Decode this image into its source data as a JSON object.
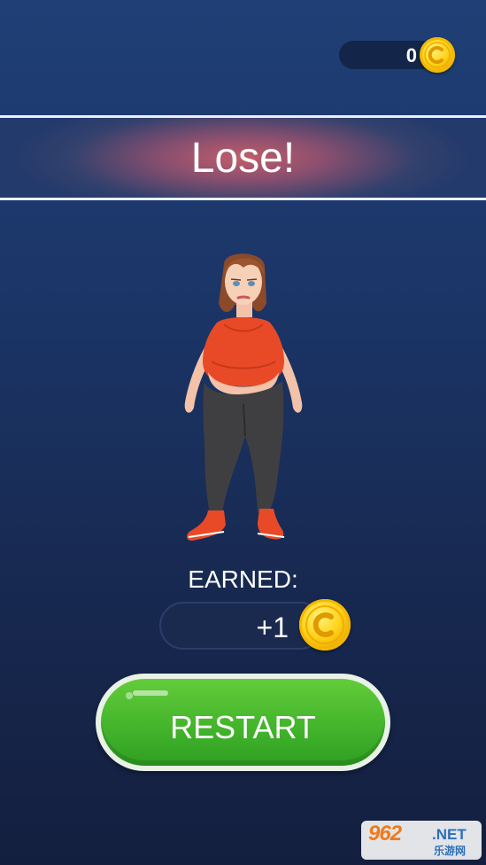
{
  "hud": {
    "coin_count": "0",
    "coin_icon": "gold-coin-icon"
  },
  "banner": {
    "title": "Lose!"
  },
  "character": {
    "icon": "overweight-woman-character"
  },
  "earned": {
    "label": "EARNED:",
    "value": "+1",
    "coin_icon": "gold-coin-icon"
  },
  "restart_button": {
    "label": "RESTART"
  },
  "watermark": {
    "main": "962",
    "net": ".NET",
    "sub": "乐游网"
  },
  "colors": {
    "background_top": "#1f3f76",
    "background_bottom": "#141f3f",
    "banner_glow": "#c15d6a",
    "button_green": "#46b72d",
    "coin_gold": "#ffd21a"
  }
}
